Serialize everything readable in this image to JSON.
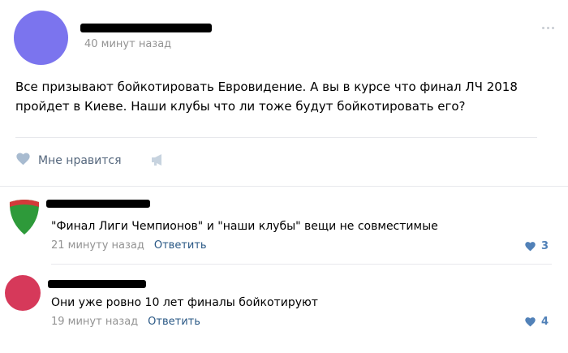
{
  "post": {
    "time": "40 минут назад",
    "text": "Все призывают бойкотировать Евровидение. А вы в курсе что финал ЛЧ 2018 пройдет в Киеве. Наши клубы что ли тоже будут бойкотировать его?",
    "like_label": "Мне нравится"
  },
  "comments": [
    {
      "text": "\"Финал Лиги Чемпионов\" и \"наши клубы\" вещи не совместимые",
      "time": "21 минуту назад",
      "reply_label": "Ответить",
      "likes": "3"
    },
    {
      "text": "Они уже ровно 10 лет финалы бойкотируют",
      "time": "19 минут назад",
      "reply_label": "Ответить",
      "likes": "4"
    }
  ],
  "colors": {
    "accent": "#5181b8",
    "link": "#2a5885",
    "meta": "#939393",
    "avatar_main": "#7b74ee",
    "avatar_comment2": "#d6395a",
    "avatar_comment1": "#2e9a3a"
  },
  "icons": [
    "more-icon",
    "heart-icon",
    "share-megaphone-icon"
  ]
}
